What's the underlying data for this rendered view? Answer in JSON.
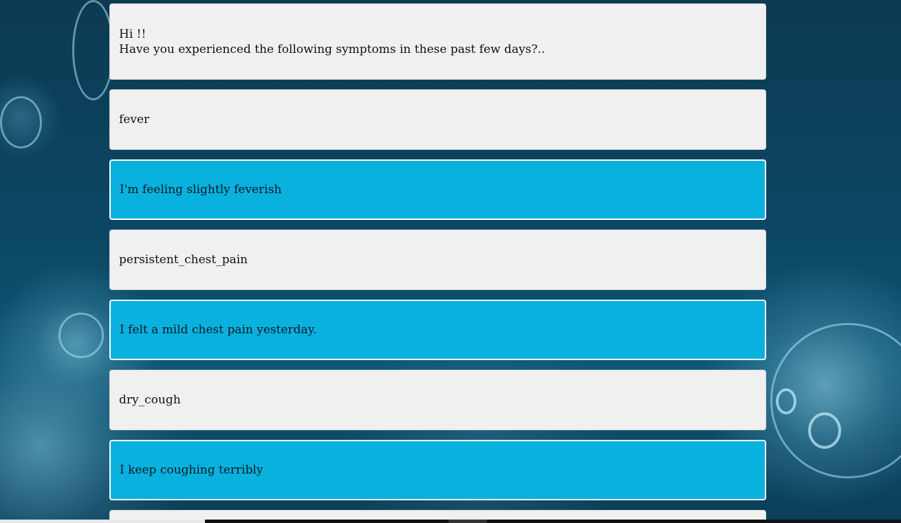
{
  "messages": [
    {
      "sender": "bot",
      "lines": [
        "Hi !!",
        "Have you experienced the following symptoms in these past few days?.."
      ]
    },
    {
      "sender": "bot",
      "text": "fever"
    },
    {
      "sender": "user",
      "text": "I'm feeling slightly feverish"
    },
    {
      "sender": "bot",
      "text": "persistent_chest_pain"
    },
    {
      "sender": "user",
      "text": "I felt a mild chest pain yesterday."
    },
    {
      "sender": "bot",
      "text": "dry_cough"
    },
    {
      "sender": "user",
      "text": "I keep coughing terribly"
    }
  ],
  "colors": {
    "bot_bubble": "#f0f0f0",
    "user_bubble": "#08b1de",
    "background": "#0b4764"
  }
}
